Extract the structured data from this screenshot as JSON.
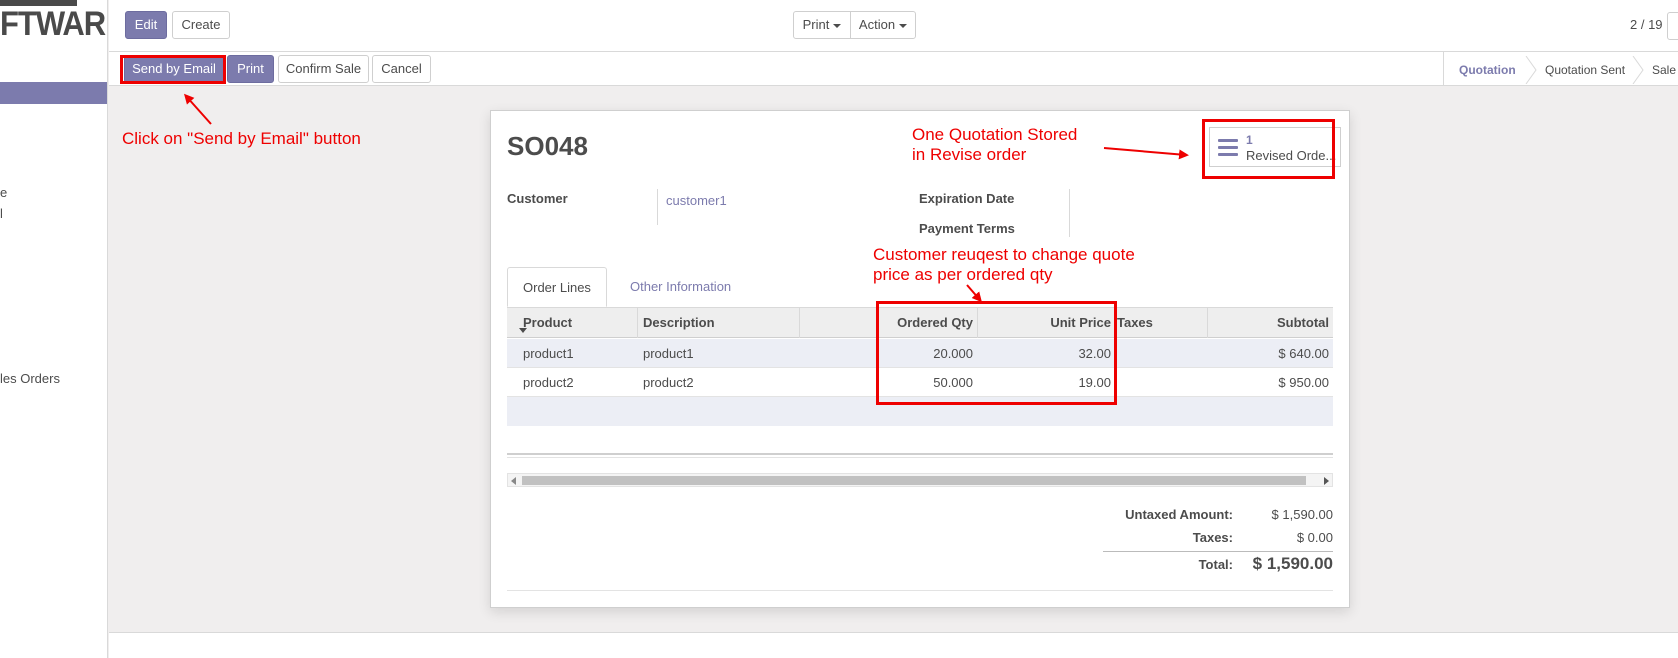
{
  "sidebar": {
    "logo_text": "FTWARE",
    "item_a": "e",
    "item_b": "l",
    "item_c": "les Orders"
  },
  "toolbar": {
    "edit_label": "Edit",
    "create_label": "Create",
    "print_label": "Print",
    "action_label": "Action",
    "pager": "2 / 19"
  },
  "actions": {
    "send_email_label": "Send by Email",
    "print_label": "Print",
    "confirm_label": "Confirm Sale",
    "cancel_label": "Cancel"
  },
  "statusbar": {
    "steps": [
      "Quotation",
      "Quotation Sent",
      "Sale"
    ],
    "active": "Quotation"
  },
  "record": {
    "name": "SO048",
    "customer_label": "Customer",
    "customer_value": "customer1",
    "expiration_label": "Expiration Date",
    "payment_terms_label": "Payment Terms",
    "smart_button": {
      "count": "1",
      "label": "Revised Orde..."
    }
  },
  "tabs": [
    "Order Lines",
    "Other Information"
  ],
  "table": {
    "columns": [
      "Product",
      "Description",
      "Ordered Qty",
      "Unit Price",
      "Taxes",
      "Subtotal"
    ],
    "rows": [
      {
        "product": "product1",
        "description": "product1",
        "qty": "20.000",
        "price": "32.00",
        "taxes": "",
        "subtotal": "$ 640.00"
      },
      {
        "product": "product2",
        "description": "product2",
        "qty": "50.000",
        "price": "19.00",
        "taxes": "",
        "subtotal": "$ 950.00"
      }
    ]
  },
  "totals": {
    "untaxed_label": "Untaxed Amount:",
    "untaxed_value": "$ 1,590.00",
    "taxes_label": "Taxes:",
    "taxes_value": "$ 0.00",
    "total_label": "Total:",
    "total_value": "$ 1,590.00"
  },
  "annotations": {
    "send_email": "Click on \"Send by Email\" button",
    "revise_line1": "One Quotation Stored",
    "revise_line2": "in Revise order",
    "qty_line1": "Customer reuqest to change quote",
    "qty_line2": "price as per ordered qty"
  },
  "colors": {
    "accent": "#7c7bad",
    "annotation": "#ee0000"
  }
}
